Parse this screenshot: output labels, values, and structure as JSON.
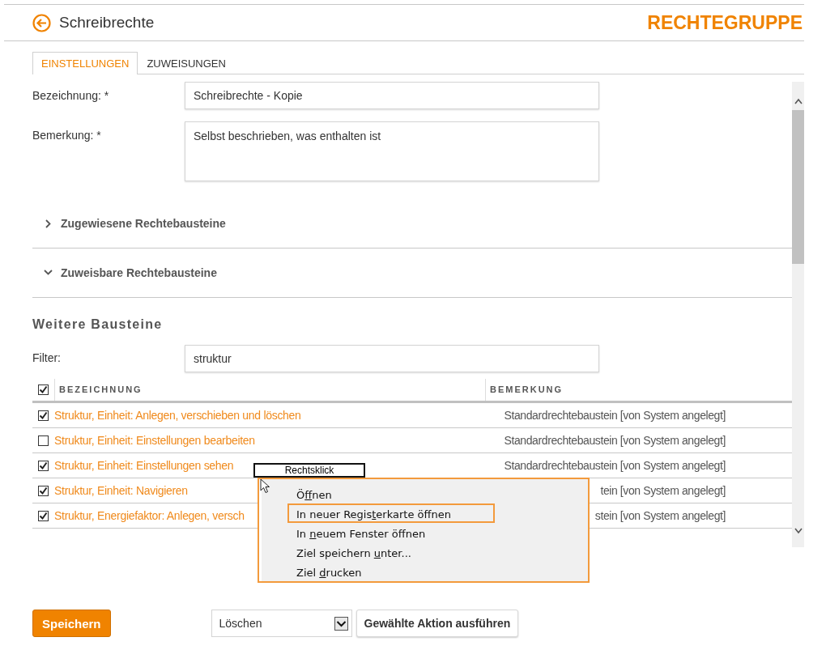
{
  "header": {
    "title": "Schreibrechte",
    "type_label": "RECHTEGRUPPE"
  },
  "tabs": [
    {
      "label": "EINSTELLUNGEN",
      "selected": true
    },
    {
      "label": "ZUWEISUNGEN",
      "selected": false
    }
  ],
  "fields": [
    {
      "label": "Bezeichnung: *",
      "kind": "input",
      "value": "Schreibrechte - Kopie"
    },
    {
      "label": "Bemerkung: *",
      "kind": "textarea",
      "value": "Selbst beschrieben, was enthalten ist"
    }
  ],
  "sections": [
    {
      "title": "Zugewiesene Rechtebausteine",
      "expanded": false
    },
    {
      "title": "Zuweisbare Rechtebausteine",
      "expanded": true
    }
  ],
  "more": {
    "heading": "Weitere Bausteine",
    "filter_label": "Filter:",
    "filter_value": "struktur"
  },
  "table": {
    "all_checked": true,
    "columns": [
      "BEZEICHNUNG",
      "BEMERKUNG"
    ],
    "rows": [
      {
        "checked": true,
        "name": "Struktur, Einheit: Anlegen, verschieben und löschen",
        "remark": "Standardrechtebaustein [von System angelegt]"
      },
      {
        "checked": false,
        "name": "Struktur, Einheit: Einstellungen bearbeiten",
        "remark": "Standardrechtebaustein [von System angelegt]"
      },
      {
        "checked": true,
        "name": "Struktur, Einheit: Einstellungen sehen",
        "remark": "Standardrechtebaustein [von System angelegt]"
      },
      {
        "checked": true,
        "name": "Struktur, Einheit: Navigieren",
        "remark": "tein [von System angelegt]"
      },
      {
        "checked": true,
        "name": "Struktur, Energiefaktor: Anlegen, versch",
        "remark": "stein [von System angelegt]"
      }
    ]
  },
  "callout": "Rechtsklick",
  "context_menu": [
    {
      "parts": [
        "Ö",
        "f",
        "fnen"
      ],
      "selected": false
    },
    {
      "parts": [
        "In neuer Regis",
        "t",
        "erkarte öffnen"
      ],
      "selected": true
    },
    {
      "parts": [
        "In ",
        "n",
        "euem Fenster öffnen"
      ],
      "selected": false
    },
    {
      "parts": [
        "Ziel speichern ",
        "u",
        "nter..."
      ],
      "selected": false
    },
    {
      "parts": [
        "Ziel ",
        "d",
        "rucken"
      ],
      "selected": false
    }
  ],
  "footer": {
    "save": "Speichern",
    "action_select": "Löschen",
    "action_button": "Gewählte Aktion ausführen"
  }
}
